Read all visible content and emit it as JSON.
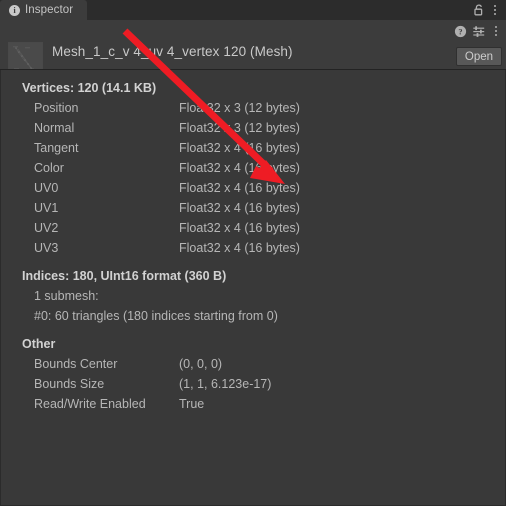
{
  "window": {
    "tab_label": "Inspector",
    "tab_icon": "info-icon",
    "lock_icon": "padlock-open-icon",
    "tab_menu_icon": "kebab-menu-icon"
  },
  "object_header": {
    "title": "Mesh_1_c_v 4_uv 4_vertex 120 (Mesh)",
    "thumbnail_icon": "mesh-preview-thumbnail",
    "help_icon": "help-icon",
    "preset_icon": "preset-settings-icon",
    "menu_icon": "kebab-menu-icon",
    "open_button_label": "Open"
  },
  "sections": [
    {
      "title": "Vertices: 120 (14.1 KB)",
      "rows": [
        {
          "key": "Position",
          "value": "Float32 x 3 (12 bytes)"
        },
        {
          "key": "Normal",
          "value": "Float32 x 3 (12 bytes)"
        },
        {
          "key": "Tangent",
          "value": "Float32 x 4 (16 bytes)"
        },
        {
          "key": "Color",
          "value": "Float32 x 4 (16 bytes)"
        },
        {
          "key": "UV0",
          "value": "Float32 x 4 (16 bytes)"
        },
        {
          "key": "UV1",
          "value": "Float32 x 4 (16 bytes)"
        },
        {
          "key": "UV2",
          "value": "Float32 x 4 (16 bytes)"
        },
        {
          "key": "UV3",
          "value": "Float32 x 4 (16 bytes)"
        }
      ]
    },
    {
      "title": "Indices: 180, UInt16 format (360 B)",
      "rows": [
        {
          "key": "1 submesh:",
          "value": ""
        },
        {
          "key": "#0: 60 triangles (180 indices starting from 0)",
          "value": ""
        }
      ]
    },
    {
      "title": "Other",
      "rows": [
        {
          "key": "Bounds Center",
          "value": "(0, 0, 0)"
        },
        {
          "key": "Bounds Size",
          "value": "(1, 1, 6.123e-17)"
        },
        {
          "key": "Read/Write Enabled",
          "value": "True"
        }
      ]
    }
  ],
  "annotation": {
    "arrow_color": "#ee1c24",
    "arrow_name": "red-annotation-arrow",
    "points_to": "UV0 Float32 x 4 (16 bytes)"
  },
  "colors": {
    "window_bg": "#383838",
    "tabbar_bg": "#2c2c2c",
    "tab_active_bg": "#3c3c3c",
    "content_bg": "#393939",
    "text": "#b6b6b6",
    "heading_text": "#d2d2d2",
    "button_bg": "#585858"
  }
}
